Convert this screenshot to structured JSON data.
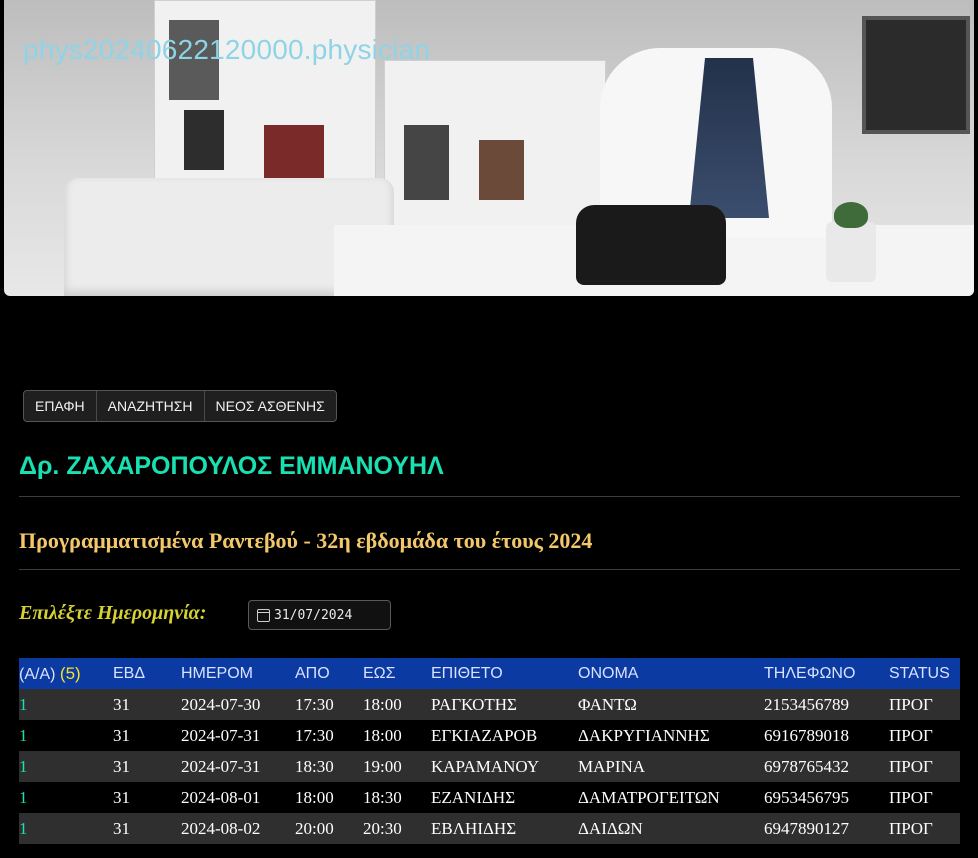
{
  "site": {
    "title": "phys20240622120000.physician"
  },
  "nav": [
    {
      "label": "ΕΠΑΦΗ"
    },
    {
      "label": "ΑΝΑΖΗΤΗΣΗ"
    },
    {
      "label": "ΝΕΟΣ ΑΣΘΕΝΗΣ"
    }
  ],
  "doctor": {
    "name": "Δρ. ΖΑΧΑΡΟΠΟΥΛΟΣ ΕΜΜΑΝΟΥΗΛ"
  },
  "schedule": {
    "title": "Προγραμματισμένα Ραντεβού - 32η εβδομάδα του έτους 2024"
  },
  "date_picker": {
    "label": "Επιλέξτε Ημερομηνία:",
    "value": "31/07/2024"
  },
  "table": {
    "headers": {
      "aa": "(Α/Α)",
      "count": "(5)",
      "week": "ΕΒΔ",
      "date": "ΗΜΕΡΟΜ",
      "from": "ΑΠΟ",
      "to": "ΕΩΣ",
      "surname": "ΕΠΙΘΕΤΟ",
      "name": "ΟΝΟΜΑ",
      "phone": "ΤΗΛΕΦΩΝΟ",
      "status": "STATUS"
    },
    "rows": [
      {
        "aa": "1",
        "week": "31",
        "date": "2024-07-30",
        "from": "17:30",
        "to": "18:00",
        "surname": "ΡΑΓΚΟΤΗΣ",
        "name": "ΦΑΝΤΩ",
        "phone": "2153456789",
        "status": "ΠΡΟΓ"
      },
      {
        "aa": "1",
        "week": "31",
        "date": "2024-07-31",
        "from": "17:30",
        "to": "18:00",
        "surname": "ΕΓΚΙΑΖΑΡΟΒ",
        "name": "ΔΑΚΡΥΓΙΑΝΝΗΣ",
        "phone": "6916789018",
        "status": "ΠΡΟΓ"
      },
      {
        "aa": "1",
        "week": "31",
        "date": "2024-07-31",
        "from": "18:30",
        "to": "19:00",
        "surname": "ΚΑΡΑΜΑΝΟΥ",
        "name": "ΜΑΡΙΝΑ",
        "phone": "6978765432",
        "status": "ΠΡΟΓ"
      },
      {
        "aa": "1",
        "week": "31",
        "date": "2024-08-01",
        "from": "18:00",
        "to": "18:30",
        "surname": "ΕΖΑΝΙΔΗΣ",
        "name": "ΔΑΜΑΤΡΟΓΕΙΤΩΝ",
        "phone": "6953456795",
        "status": "ΠΡΟΓ"
      },
      {
        "aa": "1",
        "week": "31",
        "date": "2024-08-02",
        "from": "20:00",
        "to": "20:30",
        "surname": "ΕΒΛΗΙΔΗΣ",
        "name": "ΔΑΙΔΩΝ",
        "phone": "6947890127",
        "status": "ΠΡΟΓ"
      }
    ]
  }
}
